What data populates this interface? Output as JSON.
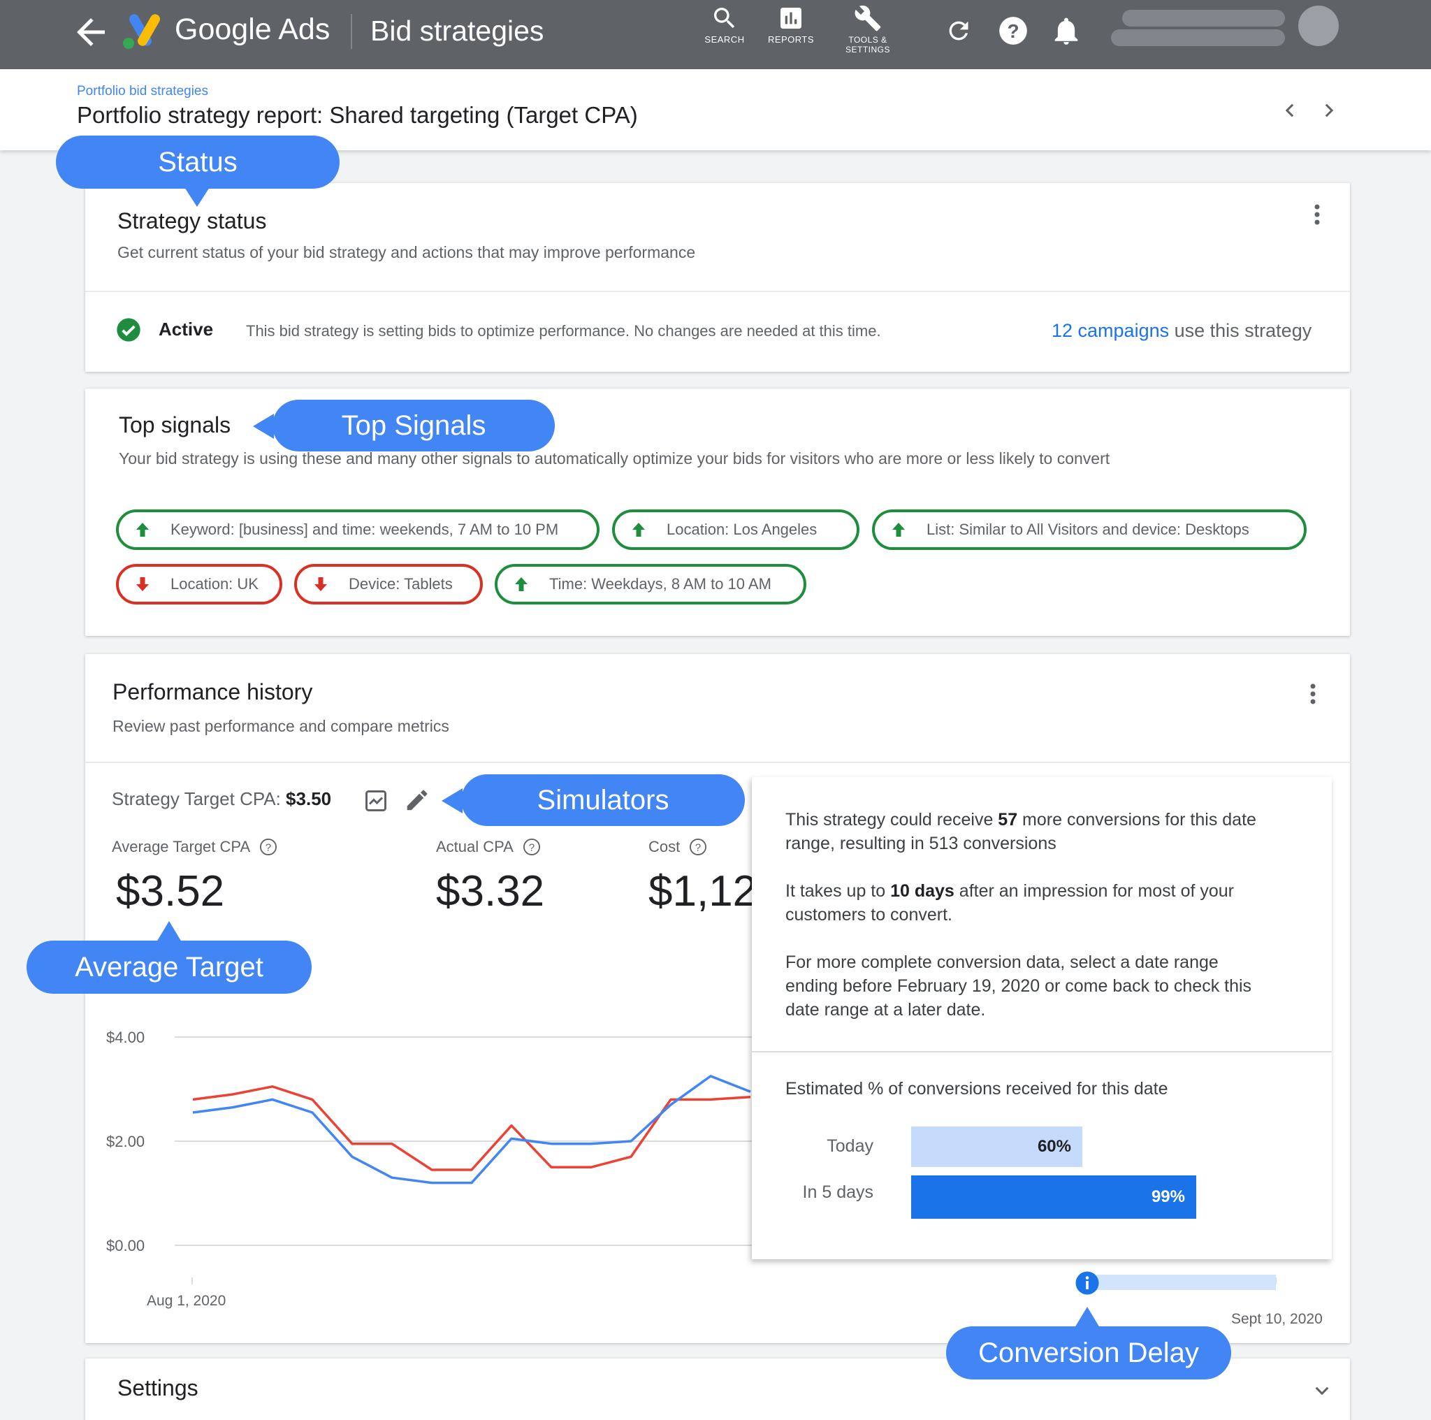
{
  "topbar": {
    "brand": "Google Ads",
    "page": "Bid strategies",
    "tools": [
      {
        "label": "SEARCH",
        "icon": "search-icon"
      },
      {
        "label": "REPORTS",
        "icon": "reports-icon"
      },
      {
        "label": "TOOLS & SETTINGS",
        "icon": "wrench-icon"
      }
    ]
  },
  "header": {
    "breadcrumb": "Portfolio bid strategies",
    "title": "Portfolio strategy report: Shared targeting (Target CPA)"
  },
  "status_card": {
    "title": "Strategy status",
    "subtitle": "Get current status of your bid strategy and actions that may improve performance",
    "status": "Active",
    "description": "This bid strategy is setting bids to optimize performance. No changes are needed at this time.",
    "campaigns_link": "12 campaigns",
    "campaigns_suffix": " use this strategy"
  },
  "signals_card": {
    "title": "Top signals",
    "subtitle": "Your bid strategy is using these and many other signals to automatically optimize your bids for visitors who are more or less likely to convert",
    "chips": [
      {
        "label": "Keyword: [business] and time: weekends, 7 AM to 10 PM",
        "direction": "up"
      },
      {
        "label": "Location: Los Angeles",
        "direction": "up"
      },
      {
        "label": "List: Similar to All Visitors and device: Desktops",
        "direction": "up"
      },
      {
        "label": "Location: UK",
        "direction": "down"
      },
      {
        "label": "Device: Tablets",
        "direction": "down"
      },
      {
        "label": "Time: Weekdays, 8 AM to 10 AM",
        "direction": "up"
      }
    ]
  },
  "performance_card": {
    "title": "Performance history",
    "subtitle": "Review past performance and compare metrics",
    "strategy_target_label": "Strategy Target CPA: ",
    "strategy_target_value": "$3.50",
    "metrics": [
      {
        "label": "Average Target CPA",
        "value": "$3.52"
      },
      {
        "label": "Actual CPA",
        "value": "$3.32"
      },
      {
        "label": "Cost",
        "value": "$1,12"
      }
    ],
    "date_start": "Aug 1, 2020",
    "date_end": "Sept 10, 2020"
  },
  "chart_data": {
    "type": "line",
    "y_ticks": [
      "$4.00",
      "$2.00",
      "$0.00"
    ],
    "ylim": [
      0,
      4
    ],
    "series": [
      {
        "color": "#ea4335",
        "values": [
          2.8,
          2.9,
          3.05,
          2.8,
          1.95,
          1.95,
          1.45,
          1.45,
          2.3,
          1.5,
          1.5,
          1.7,
          2.8,
          2.8,
          2.85
        ]
      },
      {
        "color": "#4285f4",
        "values": [
          2.55,
          2.65,
          2.8,
          2.55,
          1.7,
          1.3,
          1.2,
          1.2,
          2.05,
          1.95,
          1.95,
          2.0,
          2.7,
          3.25,
          2.95
        ]
      }
    ]
  },
  "simulator": {
    "p1_a": "This strategy could receive ",
    "p1_b": "57",
    "p1_c": " more conversions for this date range, resulting in 513 conversions",
    "p2_a": "It takes up to ",
    "p2_b": "10 days",
    "p2_c": " after an impression for most of your customers to convert.",
    "p3": "For more complete conversion data, select a date range ending before February 19, 2020 or come back to check this date range at a later date.",
    "estimate_title": "Estimated % of conversions received for this date",
    "bars": [
      {
        "label": "Today",
        "value": "60%",
        "fraction": 0.6
      },
      {
        "label": "In 5 days",
        "value": "99%",
        "fraction": 0.99
      }
    ]
  },
  "settings_card": {
    "title": "Settings"
  },
  "callouts": {
    "status": "Status",
    "top_signals": "Top Signals",
    "simulators": "Simulators",
    "average_target": "Average Target",
    "conversion_delay": "Conversion Delay"
  },
  "colors": {
    "topbar": "#5f6368",
    "callout": "#4285f4",
    "positive": "#1e8e3e",
    "negative": "#d93025",
    "link": "#1a73e8"
  }
}
